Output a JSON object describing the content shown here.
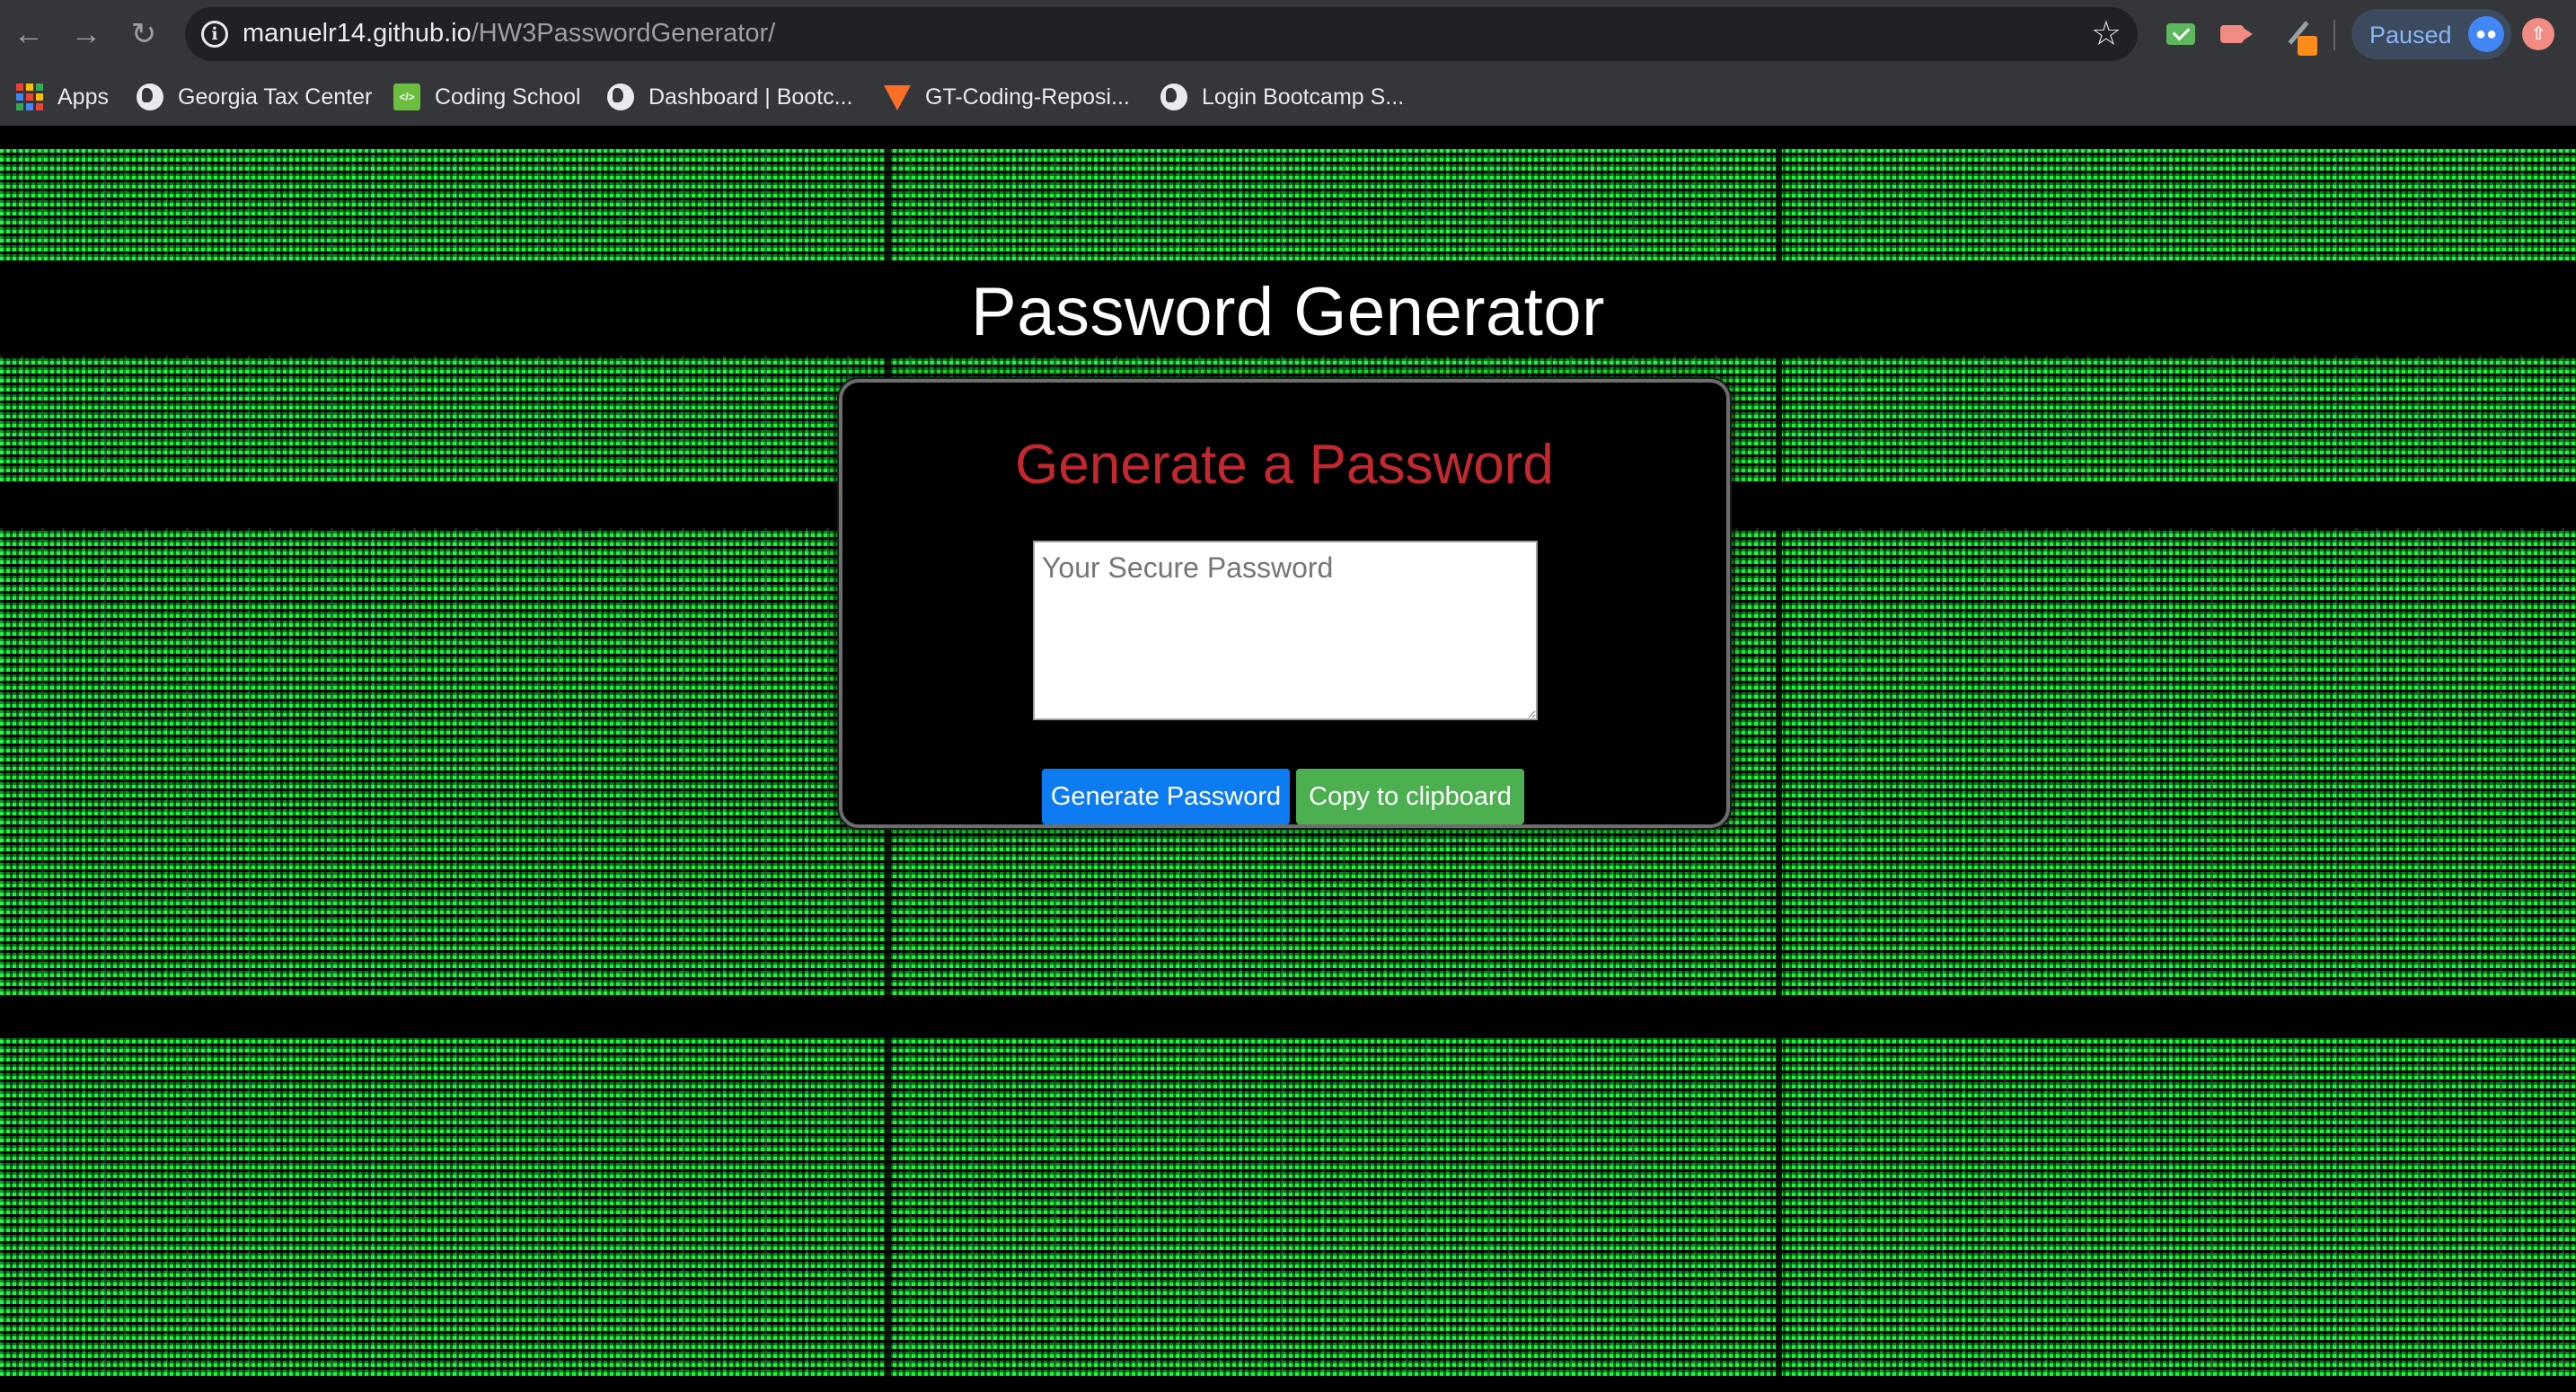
{
  "browser": {
    "url_host": "manuelr14.github.io",
    "url_path": "/HW3PasswordGenerator/",
    "profile_status": "Paused",
    "icons": {
      "back": "arrow-left",
      "forward": "arrow-right",
      "reload": "reload",
      "site_info": "info",
      "bookmark_star": "star",
      "profile_avatar": "avatar"
    }
  },
  "bookmarks": [
    {
      "label": "Apps",
      "icon": "apps-grid-icon"
    },
    {
      "label": "Georgia Tax Center",
      "icon": "globe-icon"
    },
    {
      "label": "Coding School",
      "icon": "coding-school-icon"
    },
    {
      "label": "Dashboard | Bootc...",
      "icon": "globe-icon"
    },
    {
      "label": "GT-Coding-Reposi...",
      "icon": "gitlab-icon"
    },
    {
      "label": "Login  Bootcamp S...",
      "icon": "globe-icon"
    }
  ],
  "page": {
    "title": "Password Generator",
    "card_title": "Generate a Password",
    "password_placeholder": "Your Secure Password",
    "password_value": "",
    "generate_label": "Generate Password",
    "copy_label": "Copy to clipboard"
  },
  "colors": {
    "card_title": "#c3282f",
    "generate_button": "#0d7cf2",
    "copy_button": "#4caf50",
    "matrix_green": "#22ff44"
  }
}
